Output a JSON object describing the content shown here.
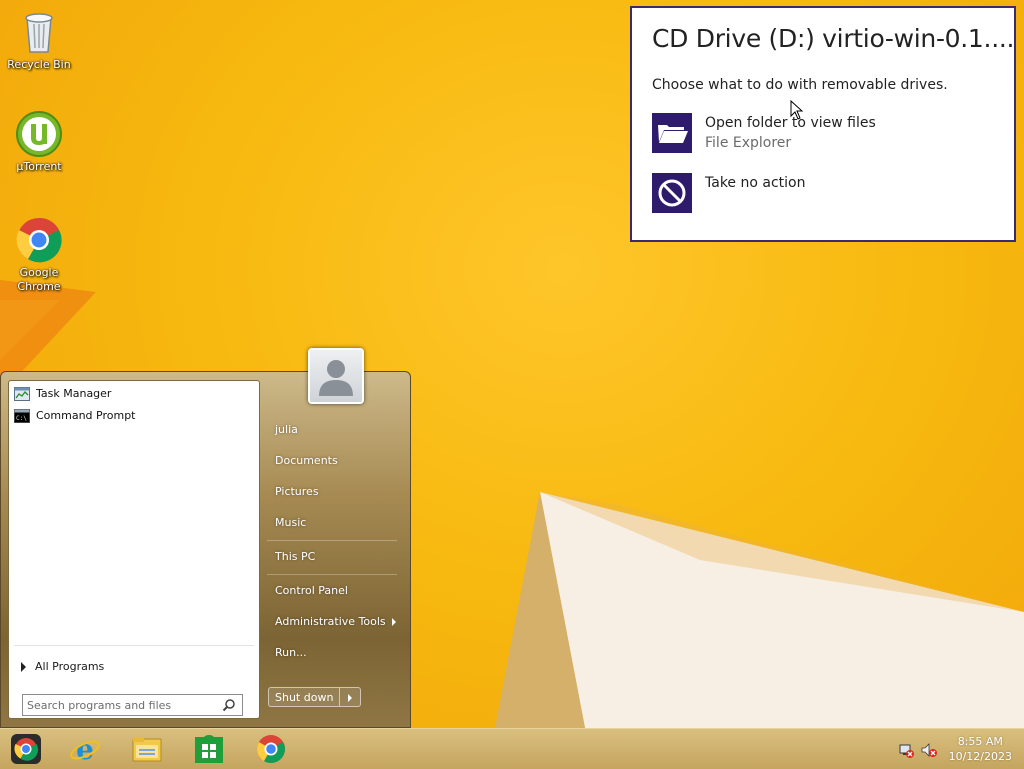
{
  "desktop": {
    "icons": [
      {
        "label": "Recycle Bin",
        "icon": "recycle-bin-icon"
      },
      {
        "label": "µTorrent",
        "icon": "utorrent-icon"
      },
      {
        "label": "Google Chrome",
        "icon": "chrome-icon"
      }
    ]
  },
  "autoplay": {
    "title": "CD Drive (D:) virtio-win-0.1....",
    "subtitle": "Choose what to do with removable drives.",
    "options": [
      {
        "label": "Open folder to view files",
        "sub": "File Explorer",
        "icon": "folder-open-icon"
      },
      {
        "label": "Take no action",
        "sub": "",
        "icon": "no-action-icon"
      }
    ],
    "accent": "#2e1b6b"
  },
  "start_menu": {
    "pinned": [
      {
        "label": "Task Manager",
        "icon": "task-manager-icon"
      },
      {
        "label": "Command Prompt",
        "icon": "command-prompt-icon"
      }
    ],
    "all_programs": "All Programs",
    "search_placeholder": "Search programs and files",
    "user_name": "julia",
    "right_items": {
      "documents": "Documents",
      "pictures": "Pictures",
      "music": "Music",
      "this_pc": "This PC",
      "control_panel": "Control Panel",
      "admin_tools": "Administrative Tools",
      "run": "Run..."
    },
    "shutdown_label": "Shut down"
  },
  "taskbar": {
    "apps": [
      "start-orb-icon",
      "internet-explorer-icon",
      "file-explorer-icon",
      "store-icon",
      "chrome-icon"
    ],
    "tray": [
      "network-disconnected-icon",
      "volume-muted-icon"
    ],
    "time": "8:55 AM",
    "date": "10/12/2023"
  }
}
